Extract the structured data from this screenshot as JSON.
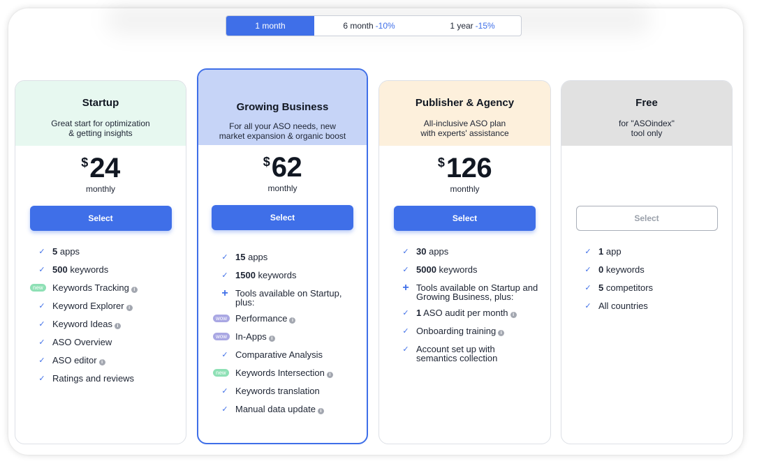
{
  "billing_toggle": {
    "options": [
      {
        "label": "1 month",
        "discount": "",
        "selected": true
      },
      {
        "label": "6 month",
        "discount": "-10%",
        "selected": false
      },
      {
        "label": "1 year",
        "discount": "-15%",
        "selected": false
      }
    ]
  },
  "plans": [
    {
      "name": "Startup",
      "description": "Great start for optimization\n& getting insights",
      "currency": "$",
      "price": "24",
      "period": "monthly",
      "button": "Select",
      "features": [
        {
          "mark": "check",
          "strong": "5",
          "text": "apps",
          "info": false
        },
        {
          "mark": "check",
          "strong": "500",
          "text": "keywords",
          "info": false
        },
        {
          "mark": "new",
          "badge": "new",
          "strong": "",
          "text": "Keywords Tracking",
          "info": true
        },
        {
          "mark": "check",
          "strong": "",
          "text": "Keyword Explorer",
          "info": true
        },
        {
          "mark": "check",
          "strong": "",
          "text": "Keyword Ideas",
          "info": true
        },
        {
          "mark": "check",
          "strong": "",
          "text": "ASO Overview",
          "info": false
        },
        {
          "mark": "check",
          "strong": "",
          "text": "ASO editor",
          "info": true
        },
        {
          "mark": "check",
          "strong": "",
          "text": "Ratings and reviews",
          "info": false
        }
      ]
    },
    {
      "name": "Growing Business",
      "description": "For all your ASO needs, new\nmarket expansion & organic boost",
      "currency": "$",
      "price": "62",
      "period": "monthly",
      "button": "Select",
      "features": [
        {
          "mark": "check",
          "strong": "15",
          "text": "apps",
          "info": false
        },
        {
          "mark": "check",
          "strong": "1500",
          "text": "keywords",
          "info": false
        },
        {
          "mark": "plus",
          "strong": "",
          "text": "Tools available on Startup,\nplus:",
          "info": false
        },
        {
          "mark": "wow",
          "badge": "wow",
          "strong": "",
          "text": "Performance",
          "info": true
        },
        {
          "mark": "wow",
          "badge": "wow",
          "strong": "",
          "text": "In-Apps",
          "info": true
        },
        {
          "mark": "check",
          "strong": "",
          "text": "Comparative Analysis",
          "info": false
        },
        {
          "mark": "new",
          "badge": "new",
          "strong": "",
          "text": "Keywords Intersection",
          "info": true
        },
        {
          "mark": "check",
          "strong": "",
          "text": "Keywords translation",
          "info": false
        },
        {
          "mark": "check",
          "strong": "",
          "text": "Manual data update",
          "info": true
        }
      ]
    },
    {
      "name": "Publisher & Agency",
      "description": "All-inclusive ASO plan\nwith experts' assistance",
      "currency": "$",
      "price": "126",
      "period": "monthly",
      "button": "Select",
      "features": [
        {
          "mark": "check",
          "strong": "30",
          "text": "apps",
          "info": false
        },
        {
          "mark": "check",
          "strong": "5000",
          "text": "keywords",
          "info": false
        },
        {
          "mark": "plus",
          "strong": "",
          "text": "Tools available on Startup and\nGrowing Business, plus:",
          "info": false
        },
        {
          "mark": "check",
          "strong": "1",
          "text": "ASO audit per month",
          "info": true
        },
        {
          "mark": "check",
          "strong": "",
          "text": "Onboarding training",
          "info": true
        },
        {
          "mark": "check",
          "strong": "",
          "text": "Account set up with\nsemantics collection",
          "info": false
        }
      ]
    },
    {
      "name": "Free",
      "description": "for \"ASOindex\"\ntool only",
      "currency": "",
      "price": "",
      "period": "",
      "button": "Select",
      "features": [
        {
          "mark": "check",
          "strong": "1",
          "text": "app",
          "info": false
        },
        {
          "mark": "check",
          "strong": "0",
          "text": "keywords",
          "info": false
        },
        {
          "mark": "check",
          "strong": "5",
          "text": " competitors",
          "info": false
        },
        {
          "mark": "check",
          "strong": "",
          "text": "All countries",
          "info": false
        }
      ]
    }
  ],
  "colors": {
    "accent": "#3f6fe8",
    "startup_header": "#e7f8f0",
    "growing_header": "#c6d4f7",
    "publisher_header": "#fdf0dc",
    "free_header": "#e1e1e1",
    "badge_new": "#8ee0b5",
    "badge_wow": "#a9a7e3"
  },
  "icons": {
    "check": "check-icon",
    "plus": "plus-icon",
    "info": "info-icon"
  }
}
